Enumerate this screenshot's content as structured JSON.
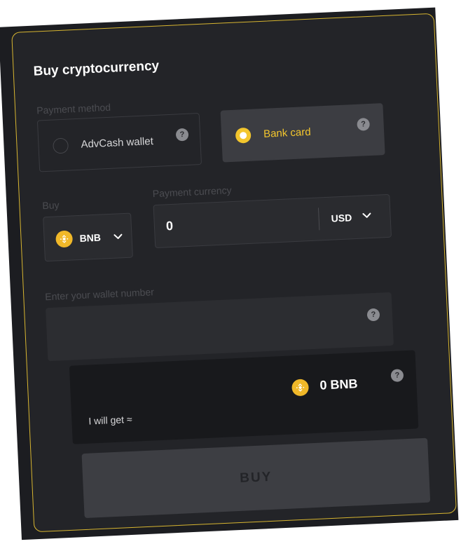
{
  "form": {
    "title": "Buy cryptocurrency",
    "payment_method": {
      "label": "Payment method",
      "options": [
        {
          "label": "AdvCash wallet",
          "selected": false,
          "help": "?"
        },
        {
          "label": "Bank card",
          "selected": true,
          "help": "?"
        }
      ]
    },
    "buy": {
      "label": "Buy",
      "coin": "BNB"
    },
    "payment_currency": {
      "label": "Payment currency",
      "amount": "0",
      "currency": "USD"
    },
    "wallet": {
      "placeholder": "Enter your wallet number",
      "help": "?"
    },
    "result": {
      "label": "I will get ≈",
      "amount": "0 BNB",
      "help": "?"
    },
    "submit_label": "BUY"
  },
  "colors": {
    "accent": "#f3c62d",
    "coin": "#f0b829",
    "card_border": "#d8b631",
    "background": "#232428"
  },
  "icons": {
    "coin": "bnb-coin-icon",
    "dropdown": "chevron-down-icon",
    "help": "question-icon",
    "radio": "radio-icon"
  }
}
